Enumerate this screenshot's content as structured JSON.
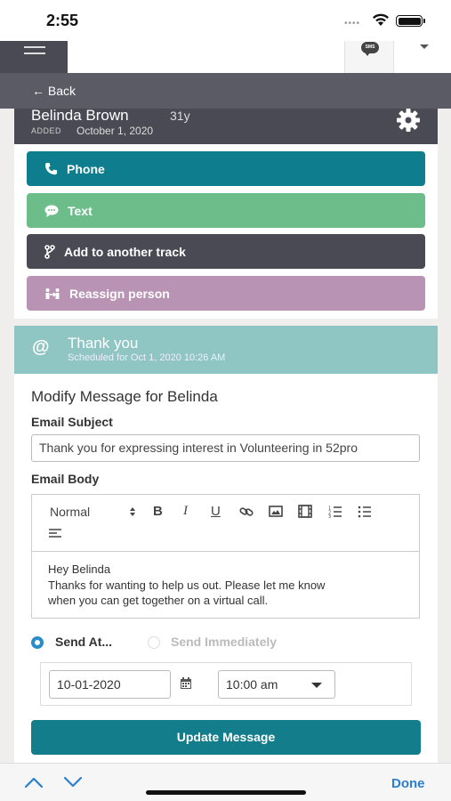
{
  "status_bar": {
    "time": "2:55",
    "signal_dots": "••••"
  },
  "nav": {
    "sms_label": "SMS"
  },
  "back": {
    "label": "← Back"
  },
  "person": {
    "name": "Belinda Brown",
    "age": "31y",
    "added_label": "ADDED",
    "added_date": "October 1, 2020"
  },
  "actions": [
    {
      "label": "Phone",
      "color": "#0e7d8e",
      "icon": "phone-icon"
    },
    {
      "label": "Text",
      "color": "#6cbd8a",
      "icon": "chat-icon"
    },
    {
      "label": "Add to another track",
      "color": "#4a4a55",
      "icon": "branch-icon"
    },
    {
      "label": "Reassign person",
      "color": "#b893b3",
      "icon": "reassign-icon"
    }
  ],
  "message": {
    "title": "Thank you",
    "scheduled": "Scheduled for Oct 1, 2020 10:26 AM",
    "modify_title": "Modify Message for Belinda",
    "subject_label": "Email Subject",
    "subject_value": "Thank you for expressing interest in Volunteering in 52pro",
    "body_label": "Email Body",
    "format_select": "Normal",
    "body_lines": [
      "Hey Belinda",
      "Thanks for wanting to help us out. Please let me know",
      "when you can get together on a virtual call."
    ],
    "send_at_label": "Send At...",
    "send_immediately_label": "Send Immediately",
    "date_value": "10-01-2020",
    "time_value": "10:00 am",
    "update_button": "Update Message"
  },
  "keyboard_bar": {
    "done_label": "Done"
  },
  "colors": {
    "accent": "#137d8c",
    "radio": "#2a8cc8",
    "header_teal": "#8fc6c3",
    "dark": "#4a4a55"
  }
}
